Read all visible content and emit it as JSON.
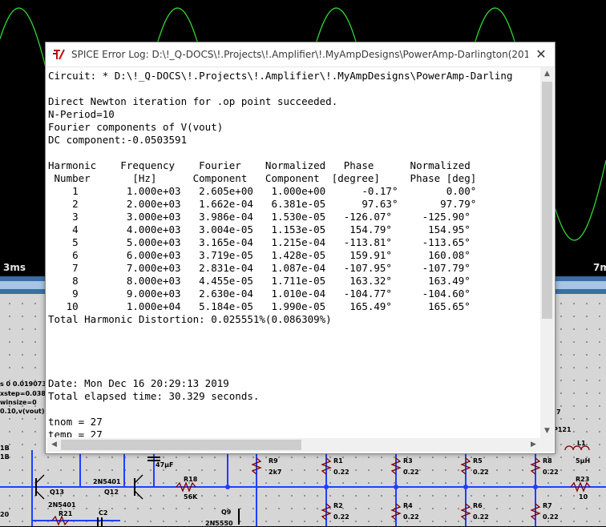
{
  "plot": {
    "x_tick_left": "3ms",
    "x_tick_right": "7m"
  },
  "schematic": {
    "labels": {
      "r9": "R9",
      "r9_val": "2k7",
      "r1": "R1",
      "r1_val": "0.22",
      "r3": "R3",
      "r3_val": "0.22",
      "r5": "R5",
      "r5_val": "0.22",
      "r8": "R8",
      "r8_val": "0.22",
      "r2": "R2",
      "r2_val": "0.22",
      "r4": "R4",
      "r4_val": "0.22",
      "r6": "R6",
      "r6_val": "0.22",
      "r7": "R7",
      "r7_val": "0.22",
      "r18": "R18",
      "r18_val": "56K",
      "r21": "R21",
      "r23": "R23",
      "r23_val": "10",
      "l1": "L1",
      "l1_val": "5µH",
      "p121": "P121",
      "q13": "Q13",
      "q13_type": "2N5401",
      "q12": "Q12",
      "q12_type": "2N5401",
      "q9": "Q9",
      "q9_type": "2N5550",
      "c2": "C2",
      "cap_val": "47µF",
      "left_a": "s 0 0.0190734",
      "left_b": "xstep=0.0381",
      "left_c": "winsize=0",
      "left_d": "0.10,v(vout)",
      "left_e": "1B",
      "left_f": "1B",
      "left_g": "20",
      "edge_7": "7"
    }
  },
  "dialog": {
    "title": "SPICE Error Log: D:\\!_Q-DOCS\\!.Projects\\!.Amplifier\\!.MyAmpDesigns\\PowerAmp-Darlington(2019)\\Darling...",
    "close_label": "✕",
    "log_lines": [
      "Circuit: * D:\\!_Q-DOCS\\!.Projects\\!.Amplifier\\!.MyAmpDesigns\\PowerAmp-Darling",
      "",
      "Direct Newton iteration for .op point succeeded.",
      "N-Period=10",
      "Fourier components of V(vout)",
      "DC component:-0.0503591",
      "",
      "Harmonic    Frequency    Fourier    Normalized   Phase      Normalized",
      " Number       [Hz]      Component   Component  [degree]     Phase [deg]",
      "    1        1.000e+03   2.605e+00   1.000e+00      -0.17°        0.00°",
      "    2        2.000e+03   1.662e-04   6.381e-05      97.63°       97.79°",
      "    3        3.000e+03   3.986e-04   1.530e-05   -126.07°     -125.90°",
      "    4        4.000e+03   3.004e-05   1.153e-05    154.79°      154.95°",
      "    5        5.000e+03   3.165e-04   1.215e-04   -113.81°     -113.65°",
      "    6        6.000e+03   3.719e-05   1.428e-05    159.91°      160.08°",
      "    7        7.000e+03   2.831e-04   1.087e-04   -107.95°     -107.79°",
      "    8        8.000e+03   4.455e-05   1.711e-05    163.32°      163.49°",
      "    9        9.000e+03   2.630e-04   1.010e-04   -104.77°     -104.60°",
      "   10        1.000e+04   5.184e-05   1.990e-05    165.49°      165.65°",
      "Total Harmonic Distortion: 0.025551%(0.086309%)",
      "",
      "",
      "",
      "",
      "Date: Mon Dec 16 20:29:13 2019",
      "Total elapsed time: 30.329 seconds.",
      "",
      "tnom = 27",
      "temp = 27",
      "method = modified trap"
    ]
  },
  "colors": {
    "trace": "#2fd82f",
    "plot_bg": "#000000",
    "schematic_bg": "#d6d6d6",
    "wire": "#1f3fff"
  }
}
